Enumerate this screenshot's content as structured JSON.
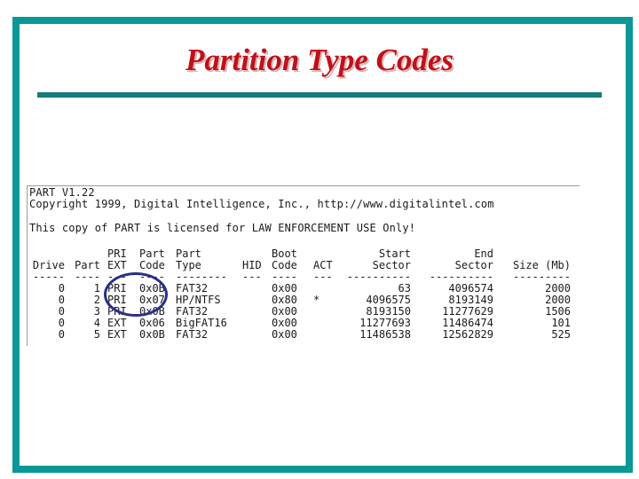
{
  "slide": {
    "title": "Partition Type Codes",
    "colors": {
      "frame": "#0a9797",
      "rule": "#167b7b",
      "title": "#c0101a",
      "annotation_circle": "#2a2f86"
    }
  },
  "console": {
    "version_line": "PART V1.22",
    "copyright_line": "Copyright 1999, Digital Intelligence, Inc., http://www.digitalintel.com",
    "license_line": "This copy of PART is licensed for LAW ENFORCEMENT USE Only!",
    "header_top": [
      "",
      "",
      "PRI",
      "Part",
      "Part",
      "",
      "Boot",
      "",
      "Start",
      "End",
      ""
    ],
    "header_bottom": [
      "Drive",
      "Part",
      "EXT",
      "Code",
      "Type",
      "HID",
      "Code",
      "ACT",
      "Sector",
      "Sector",
      "Size (Mb)"
    ],
    "separator": [
      "-----",
      "----",
      "---",
      "----",
      "--------",
      "---",
      "----",
      "---",
      "----------",
      "----------",
      "---------"
    ],
    "rows": [
      [
        "0",
        "1",
        "PRI",
        "0x0B",
        "FAT32",
        "",
        "0x00",
        "",
        "63",
        "4096574",
        "2000"
      ],
      [
        "0",
        "2",
        "PRI",
        "0x07",
        "HP/NTFS",
        "",
        "0x80",
        "*",
        "4096575",
        "8193149",
        "2000"
      ],
      [
        "0",
        "3",
        "PRI",
        "0x0B",
        "FAT32",
        "",
        "0x00",
        "",
        "8193150",
        "11277629",
        "1506"
      ],
      [
        "0",
        "4",
        "EXT",
        "0x06",
        "BigFAT16",
        "",
        "0x00",
        "",
        "11277693",
        "11486474",
        "101"
      ],
      [
        "0",
        "5",
        "EXT",
        "0x0B",
        "FAT32",
        "",
        "0x00",
        "",
        "11486538",
        "12562829",
        "525"
      ]
    ],
    "annotation": "circle-around-pri-code-rows-1-2"
  }
}
